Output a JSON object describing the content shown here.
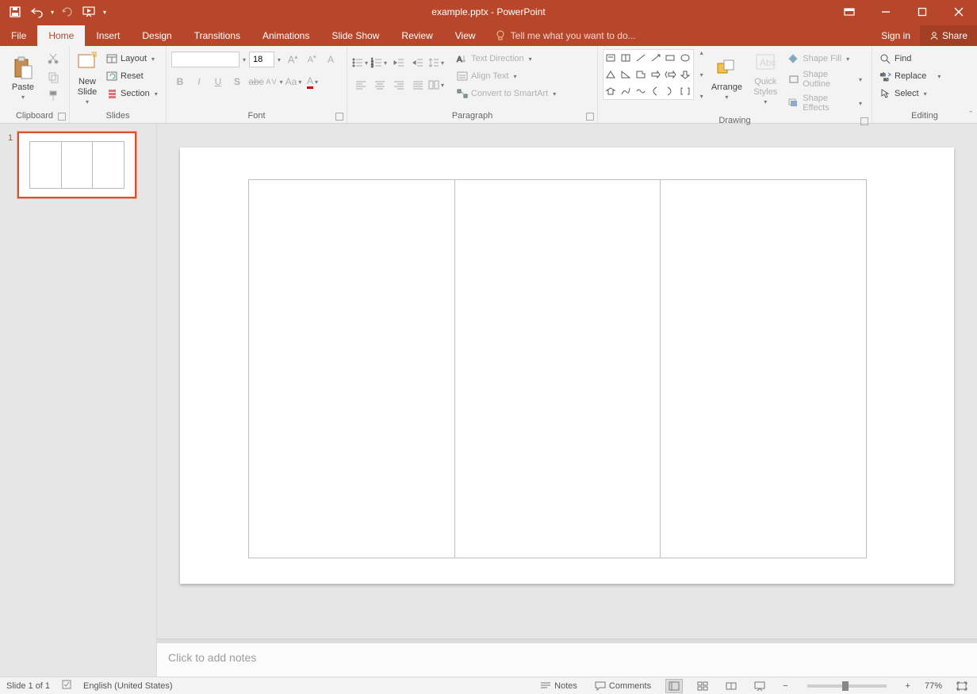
{
  "title": "example.pptx - PowerPoint",
  "qat": {
    "save": "Save",
    "undo": "Undo",
    "redo": "Redo",
    "start": "Start From Beginning"
  },
  "tabs": {
    "file": "File",
    "home": "Home",
    "insert": "Insert",
    "design": "Design",
    "transitions": "Transitions",
    "animations": "Animations",
    "slideshow": "Slide Show",
    "review": "Review",
    "view": "View"
  },
  "tellme": "Tell me what you want to do...",
  "signin": "Sign in",
  "share": "Share",
  "ribbon": {
    "clipboard": {
      "label": "Clipboard",
      "paste": "Paste"
    },
    "slides": {
      "label": "Slides",
      "newslide": "New\nSlide",
      "layout": "Layout",
      "reset": "Reset",
      "section": "Section"
    },
    "font": {
      "label": "Font",
      "size": "18"
    },
    "paragraph": {
      "label": "Paragraph",
      "textdir": "Text Direction",
      "align": "Align Text",
      "smartart": "Convert to SmartArt"
    },
    "drawing": {
      "label": "Drawing",
      "arrange": "Arrange",
      "quick": "Quick\nStyles",
      "fill": "Shape Fill",
      "outline": "Shape Outline",
      "effects": "Shape Effects"
    },
    "editing": {
      "label": "Editing",
      "find": "Find",
      "replace": "Replace",
      "select": "Select"
    }
  },
  "thumb": {
    "number": "1"
  },
  "notes_placeholder": "Click to add notes",
  "status": {
    "slide": "Slide 1 of 1",
    "lang": "English (United States)",
    "notes": "Notes",
    "comments": "Comments",
    "zoom": "77%"
  }
}
